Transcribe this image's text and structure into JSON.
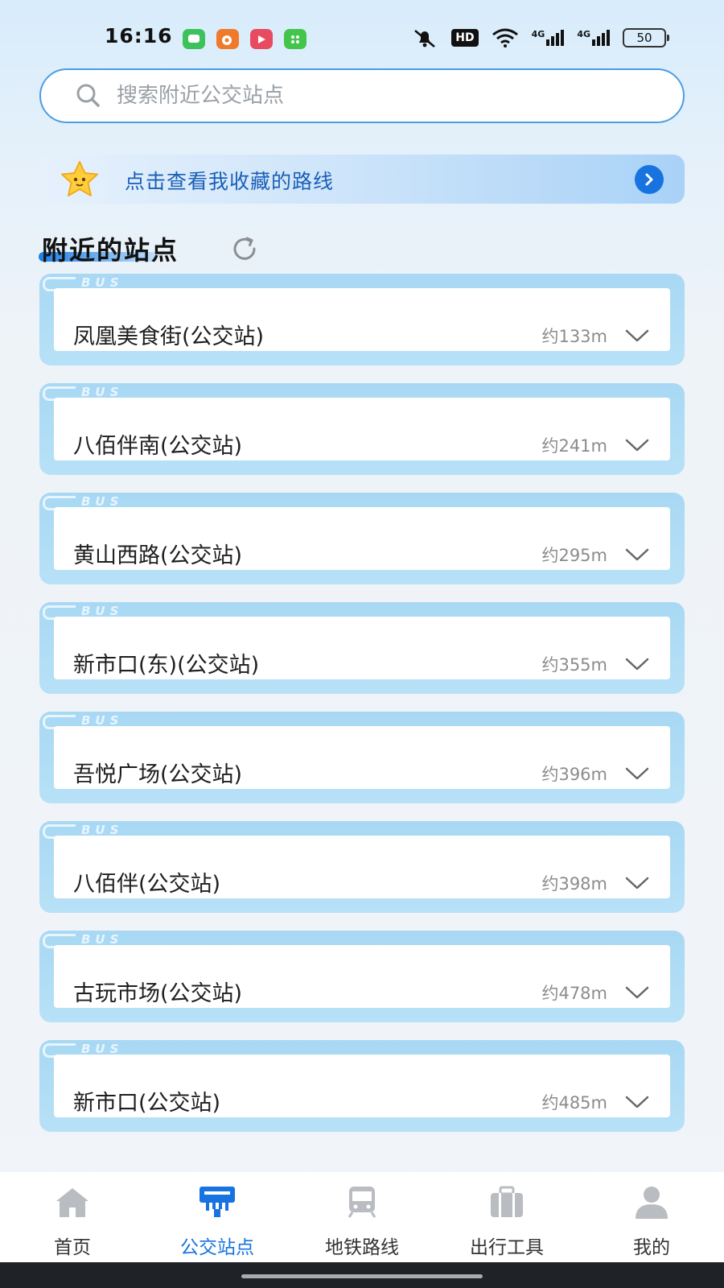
{
  "status_bar": {
    "time": "16:16",
    "hd_badge": "HD",
    "signal_1": "4G",
    "signal_2": "4G",
    "battery": "50"
  },
  "search": {
    "placeholder": "搜索附近公交站点"
  },
  "favorites_banner": {
    "text": "点击查看我收藏的路线"
  },
  "nearby": {
    "title": "附近的站点",
    "bus_tag": "BUS",
    "stops": [
      {
        "name": "凤凰美食街(公交站)",
        "distance": "约133m"
      },
      {
        "name": "八佰伴南(公交站)",
        "distance": "约241m"
      },
      {
        "name": "黄山西路(公交站)",
        "distance": "约295m"
      },
      {
        "name": "新市口(东)(公交站)",
        "distance": "约355m"
      },
      {
        "name": "吾悦广场(公交站)",
        "distance": "约396m"
      },
      {
        "name": "八佰伴(公交站)",
        "distance": "约398m"
      },
      {
        "name": "古玩市场(公交站)",
        "distance": "约478m"
      },
      {
        "name": "新市口(公交站)",
        "distance": "约485m"
      }
    ]
  },
  "bottom_nav": {
    "items": [
      {
        "label": "首页",
        "icon": "home-icon"
      },
      {
        "label": "公交站点",
        "icon": "bus-stop-icon"
      },
      {
        "label": "地铁路线",
        "icon": "metro-icon"
      },
      {
        "label": "出行工具",
        "icon": "briefcase-icon"
      },
      {
        "label": "我的",
        "icon": "user-icon"
      }
    ],
    "active_index": 1
  },
  "colors": {
    "accent": "#1773e0",
    "card_frame": "#b3def6",
    "inactive_icon": "#b9bcc0"
  }
}
